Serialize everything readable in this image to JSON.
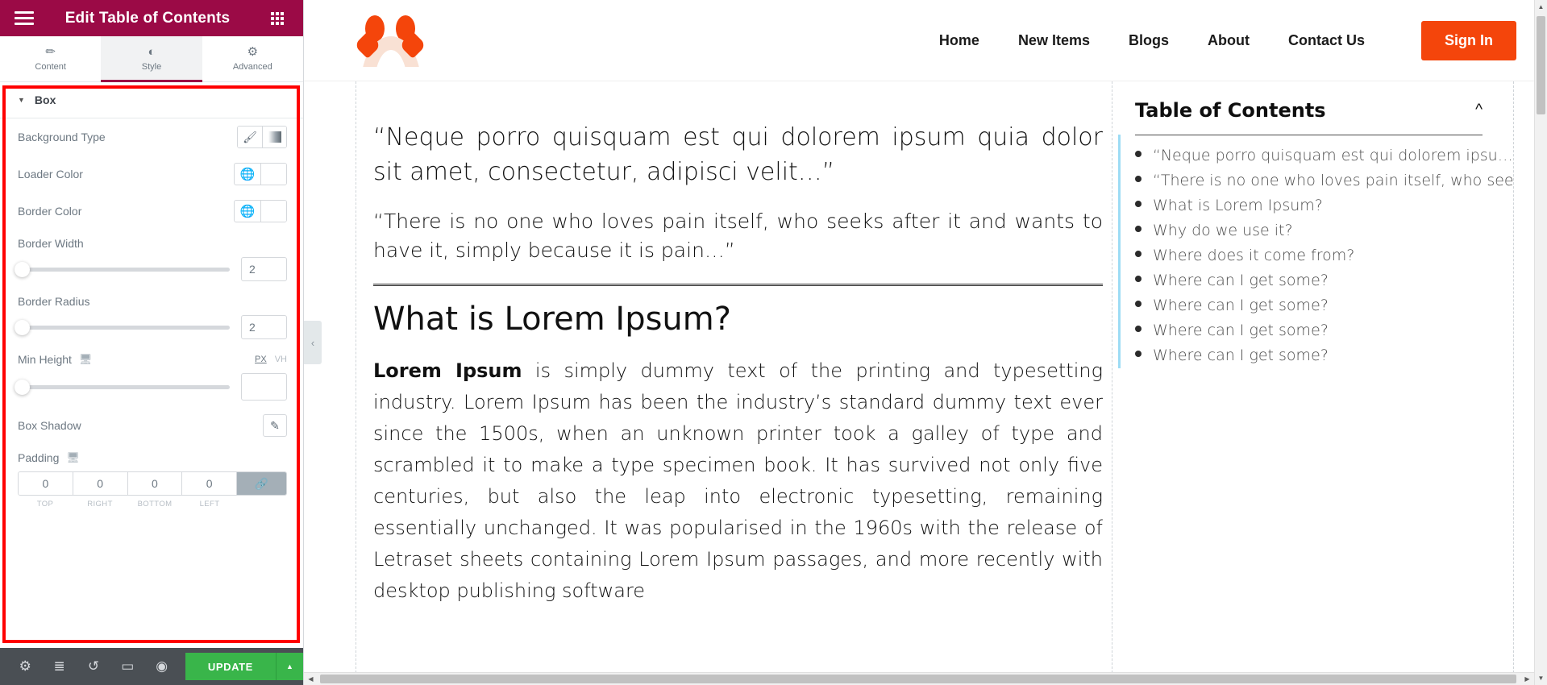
{
  "panel": {
    "header": {
      "title": "Edit Table of Contents",
      "menu_icon": "hamburger-icon",
      "apps_icon": "grid-apps-icon"
    },
    "tabs": [
      {
        "label": "Content",
        "icon": "pencil-icon",
        "active": false
      },
      {
        "label": "Style",
        "icon": "contrast-half-circle-icon",
        "active": true
      },
      {
        "label": "Advanced",
        "icon": "gear-icon",
        "active": false
      }
    ],
    "section": {
      "title": "Box",
      "caret": "▼",
      "highlight_color": "#FF0000"
    },
    "controls": {
      "background_type": {
        "label": "Background Type",
        "options": [
          {
            "icon": "brush-icon",
            "name": "classic"
          },
          {
            "icon": "gradient-icon",
            "name": "gradient"
          }
        ]
      },
      "loader_color": {
        "label": "Loader Color",
        "globe_icon": "globe-icon",
        "swatch": ""
      },
      "border_color": {
        "label": "Border Color",
        "globe_icon": "globe-icon",
        "swatch": ""
      },
      "border_width": {
        "label": "Border Width",
        "value": "2",
        "slider_pct": 0
      },
      "border_radius": {
        "label": "Border Radius",
        "value": "2",
        "slider_pct": 0
      },
      "min_height": {
        "label": "Min Height",
        "device_icon": "desktop-icon",
        "value": "",
        "units": [
          {
            "label": "PX",
            "active": true
          },
          {
            "label": "VH",
            "active": false
          }
        ],
        "slider_pct": 0
      },
      "box_shadow": {
        "label": "Box Shadow",
        "edit_icon": "pencil-edit-icon"
      },
      "padding": {
        "label": "Padding",
        "device_icon": "desktop-icon",
        "values": [
          "0",
          "0",
          "0",
          "0"
        ],
        "sides": [
          "TOP",
          "RIGHT",
          "BOTTOM",
          "LEFT"
        ],
        "link_icon": "link-icon",
        "linked": true
      }
    },
    "footer": {
      "icons": [
        {
          "name": "settings-gear-icon",
          "glyph": "⚙"
        },
        {
          "name": "navigator-layers-icon",
          "glyph": "≣"
        },
        {
          "name": "history-revisions-icon",
          "glyph": "↺"
        },
        {
          "name": "responsive-mode-icon",
          "glyph": "▭"
        },
        {
          "name": "preview-eye-icon",
          "glyph": "◉"
        }
      ],
      "update_label": "UPDATE",
      "update_color": "#39B54A",
      "update_caret": "▲"
    }
  },
  "preview": {
    "collapse_handle": "‹",
    "site_header": {
      "logo_name": "brand-logo",
      "logo_colors": {
        "primary": "#F4450B",
        "secondary": "#F9E1D4"
      },
      "nav": [
        {
          "label": "Home"
        },
        {
          "label": "New Items"
        },
        {
          "label": "Blogs"
        },
        {
          "label": "About"
        },
        {
          "label": "Contact Us"
        }
      ],
      "cta": {
        "label": "Sign In",
        "color": "#F4450B"
      }
    },
    "article": {
      "quote1": "“Neque porro quisquam est qui dolorem ipsum quia dolor sit amet, consectetur, adipisci velit…”",
      "quote2": "“There is no one who loves pain itself, who seeks after it and wants to have it, simply because it is pain…”",
      "heading": "What is Lorem Ipsum?",
      "paragraph_lead": "Lorem Ipsum",
      "paragraph_rest": " is simply dummy text of the printing and typesetting industry. Lorem Ipsum has been the industry’s standard dummy text ever since the 1500s, when an unknown printer took a galley of type and scrambled it to make a type specimen book. It has survived not only five centuries, but also the leap into electronic typesetting, remaining essentially unchanged. It was popularised in the 1960s with the release of Letraset sheets containing Lorem Ipsum passages, and more recently with desktop publishing software"
    },
    "toc": {
      "title": "Table of Contents",
      "collapse_icon": "chevron-up-icon",
      "highlight_border": "#9ddcf5",
      "items": [
        "“Neque porro quisquam est qui dolorem ipsu…",
        "“There is no one who loves pain itself, who see…",
        "What is Lorem Ipsum?",
        "Why do we use it?",
        "Where does it come from?",
        "Where can I get some?",
        "Where can I get some?",
        "Where can I get some?",
        "Where can I get some?"
      ]
    }
  },
  "scrollbars": {
    "vertical": {
      "up": "▲",
      "down": "▼"
    },
    "horizontal": {
      "left": "◀",
      "right": "▶"
    }
  }
}
